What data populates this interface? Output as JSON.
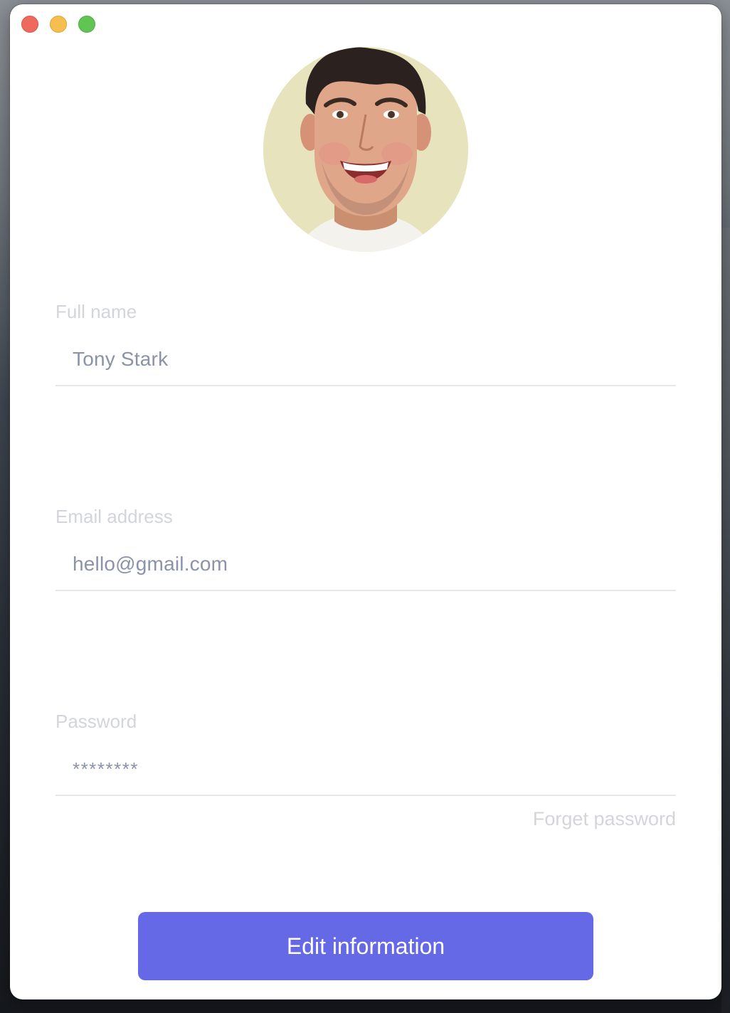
{
  "window": {
    "controls": [
      "close",
      "minimize",
      "zoom"
    ]
  },
  "profile": {
    "avatar_icon": "person-avatar"
  },
  "fields": {
    "full_name": {
      "label": "Full name",
      "value": "Tony Stark"
    },
    "email": {
      "label": "Email address",
      "value": "hello@gmail.com"
    },
    "password": {
      "label": "Password",
      "value": "********"
    }
  },
  "links": {
    "forgot_password": "Forget password"
  },
  "actions": {
    "edit_label": "Edit information"
  },
  "colors": {
    "accent": "#6569e6",
    "label": "#d3d5da",
    "input_text": "#8a93a8",
    "close": "#ee6a5f",
    "minimize": "#f5be4f",
    "zoom": "#61c554"
  }
}
